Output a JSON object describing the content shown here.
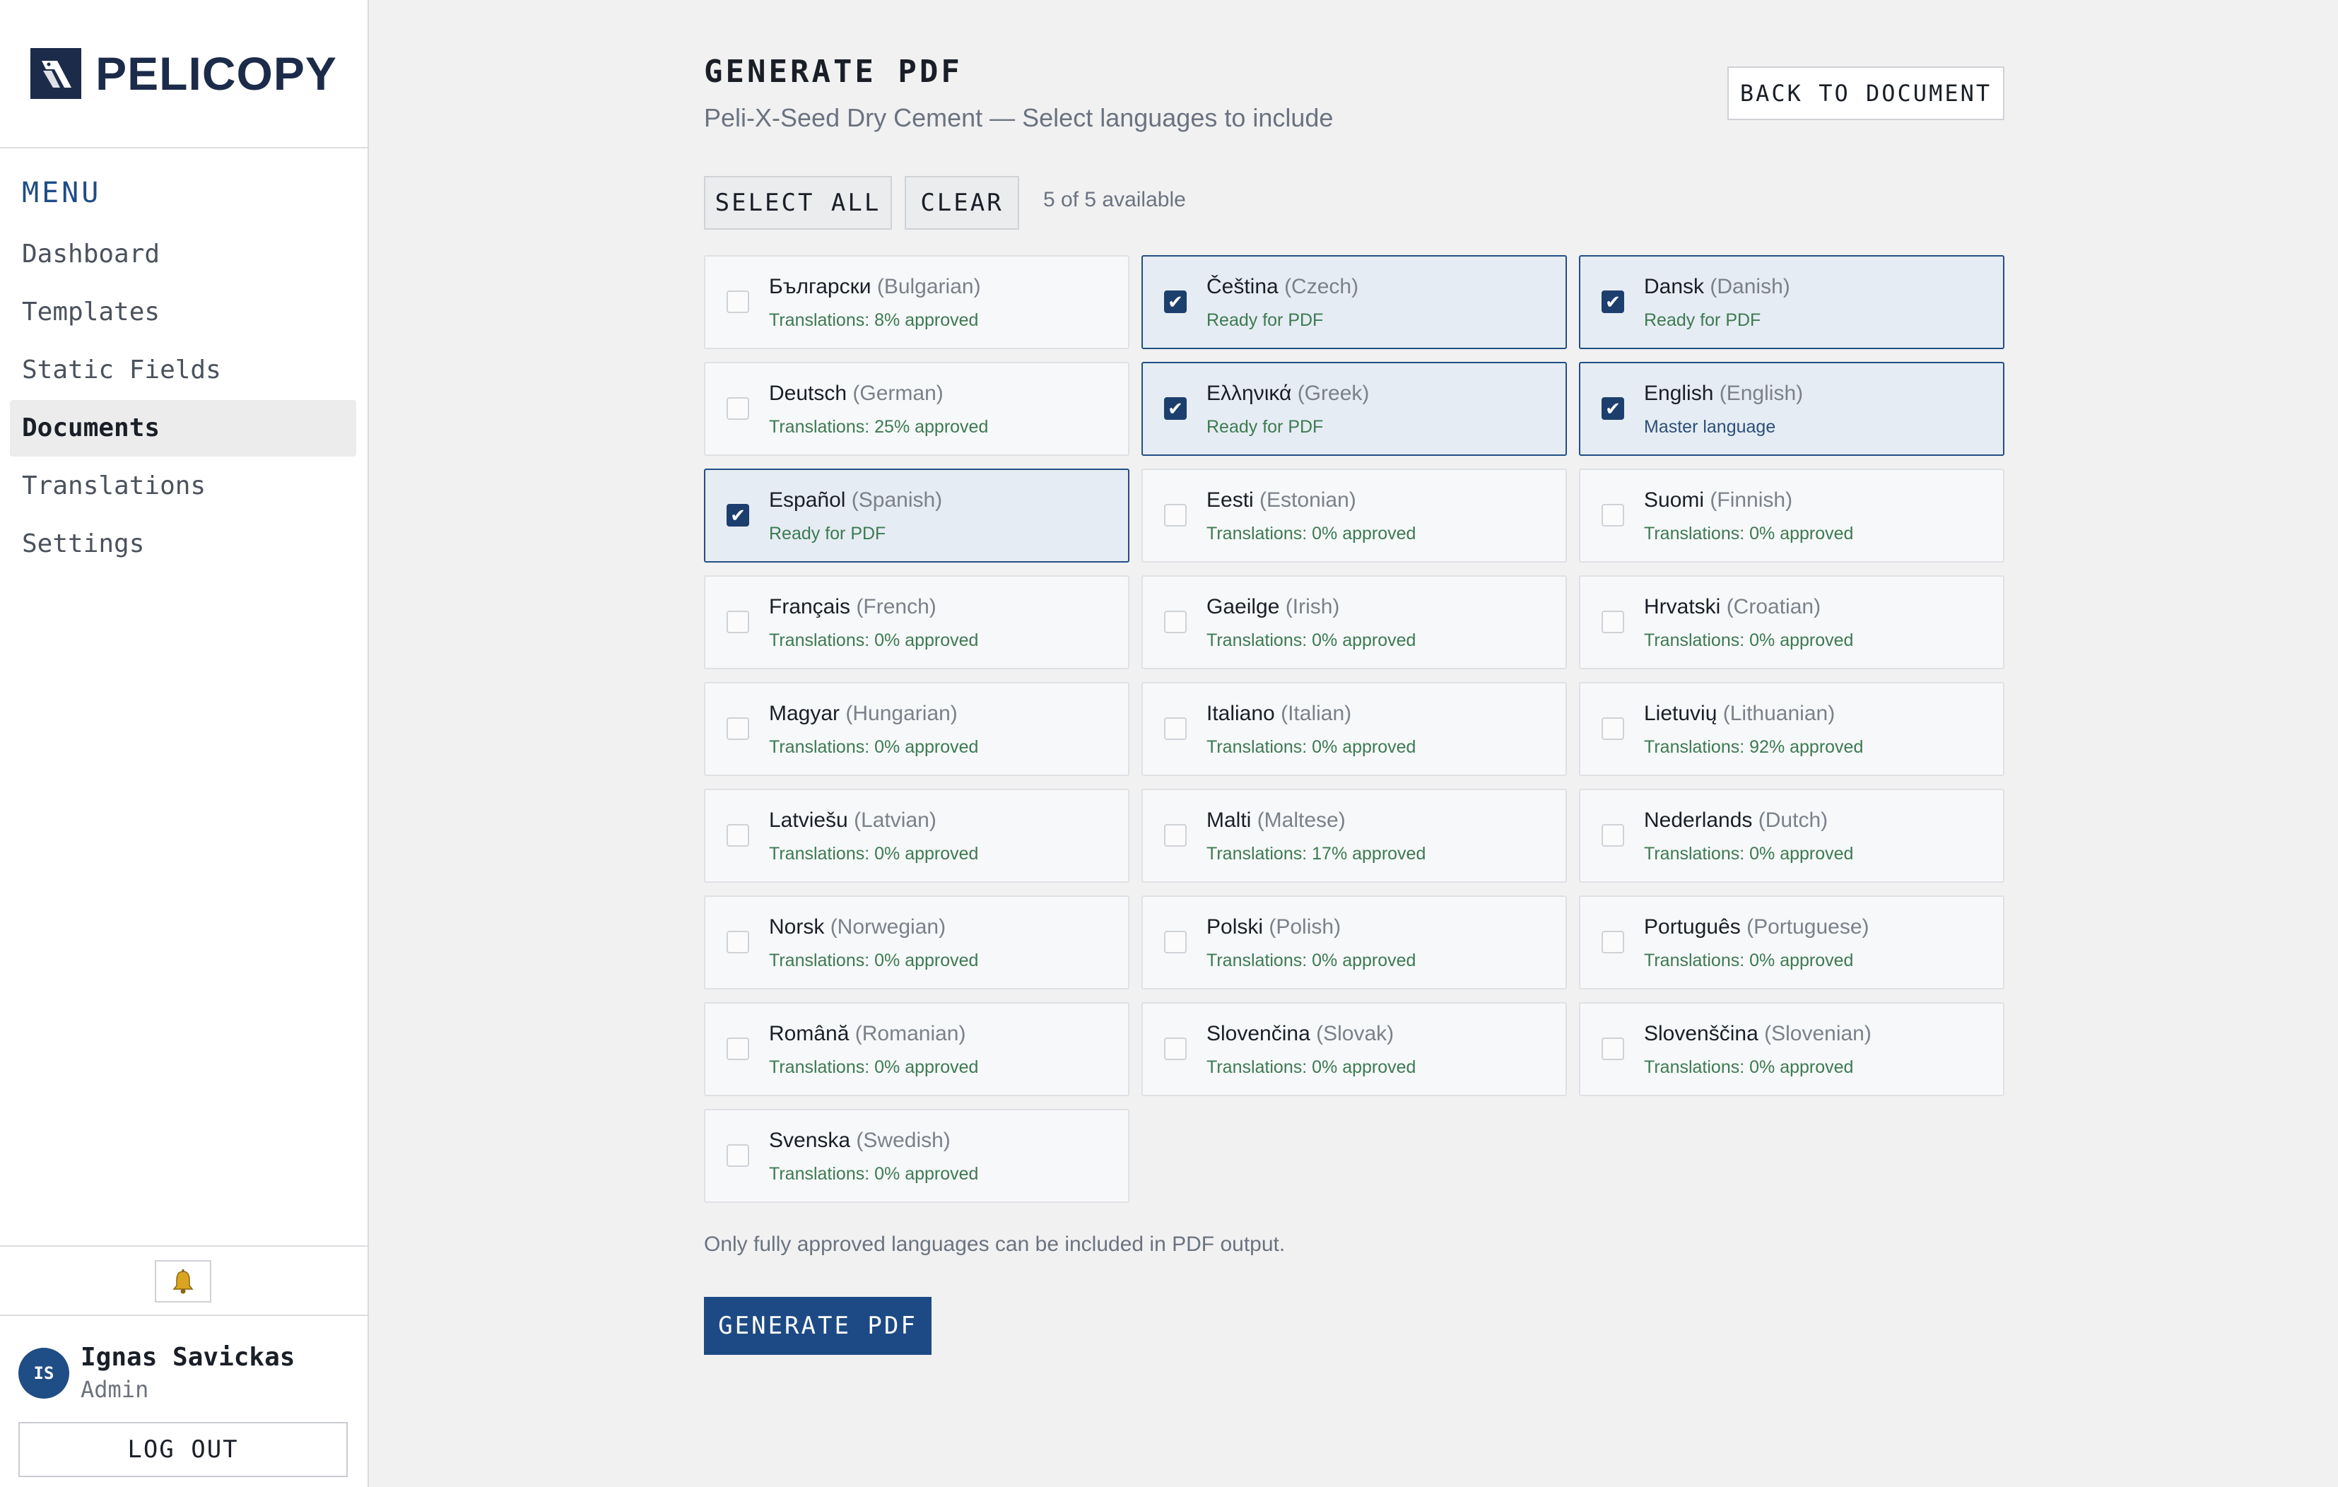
{
  "brand": {
    "name": "PELICOPY",
    "logo_icon": "pelican-logo-icon"
  },
  "sidebar": {
    "menu_title": "MENU",
    "items": [
      {
        "label": "Dashboard",
        "active": false
      },
      {
        "label": "Templates",
        "active": false
      },
      {
        "label": "Static Fields",
        "active": false
      },
      {
        "label": "Documents",
        "active": true
      },
      {
        "label": "Translations",
        "active": false
      },
      {
        "label": "Settings",
        "active": false
      }
    ],
    "notifications_icon": "bell-icon",
    "user": {
      "initials": "IS",
      "name": "Ignas Savickas",
      "role": "Admin"
    },
    "logout_label": "LOG OUT"
  },
  "header": {
    "title": "GENERATE PDF",
    "subtitle": "Peli-X-Seed Dry Cement — Select languages to include",
    "back_label": "BACK TO DOCUMENT"
  },
  "toolbar": {
    "select_all_label": "SELECT ALL",
    "clear_label": "CLEAR",
    "available_text": "5 of 5 available"
  },
  "languages": [
    {
      "native": "Български",
      "english": "(Bulgarian)",
      "status": "Translations: 8% approved",
      "checked": false
    },
    {
      "native": "Čeština",
      "english": "(Czech)",
      "status": "Ready for PDF",
      "checked": true
    },
    {
      "native": "Dansk",
      "english": "(Danish)",
      "status": "Ready for PDF",
      "checked": true
    },
    {
      "native": "Deutsch",
      "english": "(German)",
      "status": "Translations: 25% approved",
      "checked": false
    },
    {
      "native": "Ελληνικά",
      "english": "(Greek)",
      "status": "Ready for PDF",
      "checked": true
    },
    {
      "native": "English",
      "english": "(English)",
      "status": "Master language",
      "checked": true,
      "master": true
    },
    {
      "native": "Español",
      "english": "(Spanish)",
      "status": "Ready for PDF",
      "checked": true
    },
    {
      "native": "Eesti",
      "english": "(Estonian)",
      "status": "Translations: 0% approved",
      "checked": false
    },
    {
      "native": "Suomi",
      "english": "(Finnish)",
      "status": "Translations: 0% approved",
      "checked": false
    },
    {
      "native": "Français",
      "english": "(French)",
      "status": "Translations: 0% approved",
      "checked": false
    },
    {
      "native": "Gaeilge",
      "english": "(Irish)",
      "status": "Translations: 0% approved",
      "checked": false
    },
    {
      "native": "Hrvatski",
      "english": "(Croatian)",
      "status": "Translations: 0% approved",
      "checked": false
    },
    {
      "native": "Magyar",
      "english": "(Hungarian)",
      "status": "Translations: 0% approved",
      "checked": false
    },
    {
      "native": "Italiano",
      "english": "(Italian)",
      "status": "Translations: 0% approved",
      "checked": false
    },
    {
      "native": "Lietuvių",
      "english": "(Lithuanian)",
      "status": "Translations: 92% approved",
      "checked": false
    },
    {
      "native": "Latviešu",
      "english": "(Latvian)",
      "status": "Translations: 0% approved",
      "checked": false
    },
    {
      "native": "Malti",
      "english": "(Maltese)",
      "status": "Translations: 17% approved",
      "checked": false
    },
    {
      "native": "Nederlands",
      "english": "(Dutch)",
      "status": "Translations: 0% approved",
      "checked": false
    },
    {
      "native": "Norsk",
      "english": "(Norwegian)",
      "status": "Translations: 0% approved",
      "checked": false
    },
    {
      "native": "Polski",
      "english": "(Polish)",
      "status": "Translations: 0% approved",
      "checked": false
    },
    {
      "native": "Português",
      "english": "(Portuguese)",
      "status": "Translations: 0% approved",
      "checked": false
    },
    {
      "native": "Română",
      "english": "(Romanian)",
      "status": "Translations: 0% approved",
      "checked": false
    },
    {
      "native": "Slovenčina",
      "english": "(Slovak)",
      "status": "Translations: 0% approved",
      "checked": false
    },
    {
      "native": "Slovenščina",
      "english": "(Slovenian)",
      "status": "Translations: 0% approved",
      "checked": false
    },
    {
      "native": "Svenska",
      "english": "(Swedish)",
      "status": "Translations: 0% approved",
      "checked": false
    }
  ],
  "footer": {
    "note": "Only fully approved languages can be included in PDF output.",
    "generate_label": "GENERATE PDF"
  },
  "colors": {
    "accent": "#1d4a84",
    "selected_card_bg": "#e6ecf3",
    "status_green": "#3c7a52"
  }
}
